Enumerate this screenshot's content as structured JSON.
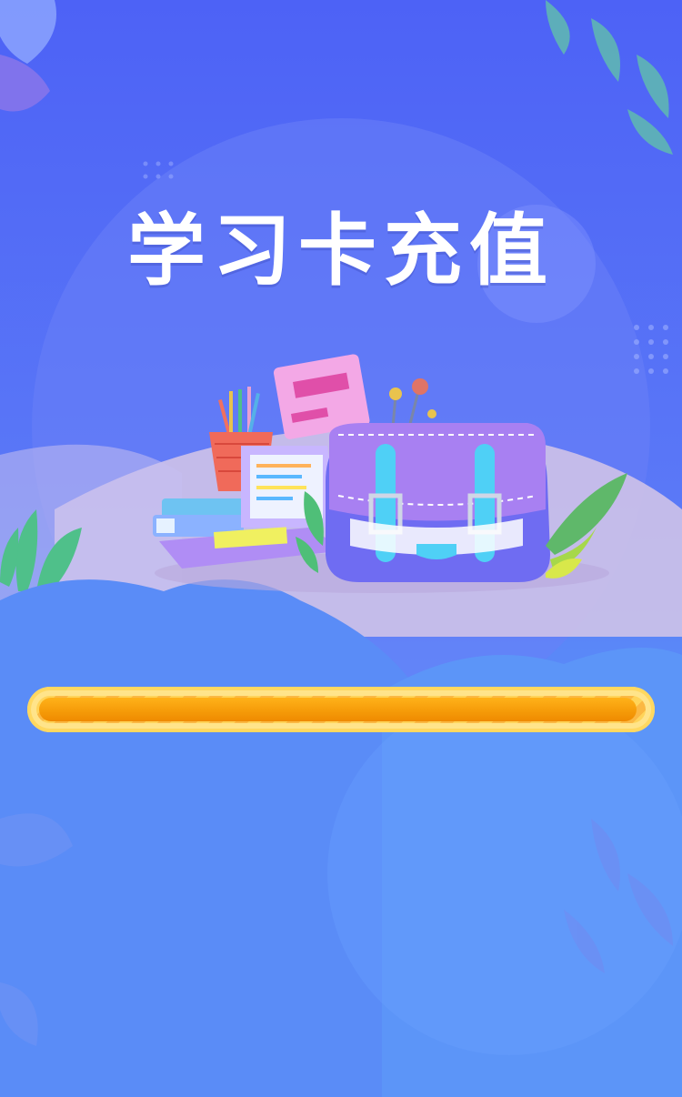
{
  "page": {
    "title": "学习卡充值"
  },
  "progress": {
    "fraction": 0.99
  },
  "colors": {
    "background_top": "#4d62f6",
    "background_bottom": "#5a8ff6",
    "progress_fill": "#f59a08",
    "progress_border": "#ffe48a"
  },
  "illustration": {
    "name": "school-supplies-illustration"
  }
}
